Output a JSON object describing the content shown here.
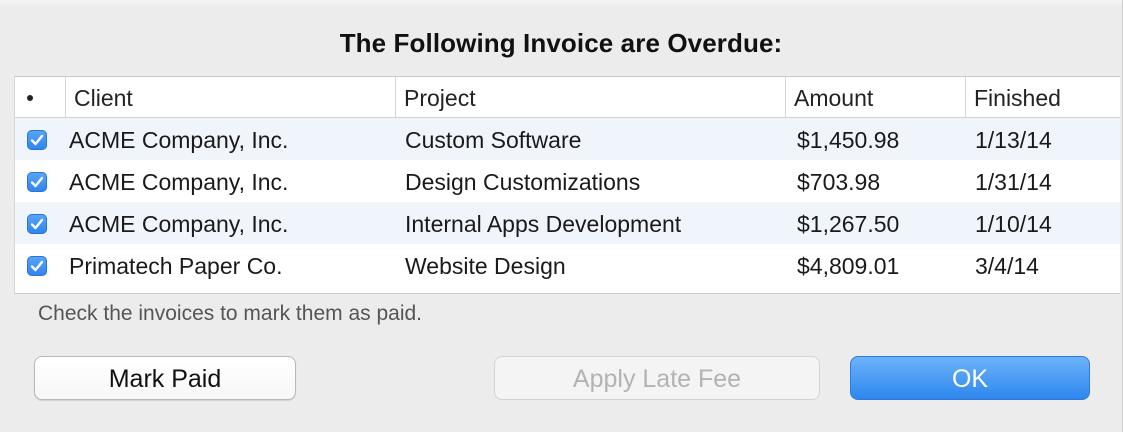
{
  "dialog": {
    "title": "The Following Invoice are Overdue:",
    "hint": "Check the invoices to mark them as paid.",
    "buttons": {
      "mark_paid": "Mark Paid",
      "apply_late_fee": "Apply Late Fee",
      "ok": "OK"
    },
    "accent_color": "#3b8df2"
  },
  "table": {
    "columns": {
      "select": "•",
      "client": "Client",
      "project": "Project",
      "amount": "Amount",
      "finished": "Finished"
    },
    "rows": [
      {
        "checked": true,
        "client": "ACME Company, Inc.",
        "project": "Custom Software",
        "amount": "$1,450.98",
        "finished": "1/13/14"
      },
      {
        "checked": true,
        "client": "ACME Company, Inc.",
        "project": "Design Customizations",
        "amount": "$703.98",
        "finished": "1/31/14"
      },
      {
        "checked": true,
        "client": "ACME Company, Inc.",
        "project": "Internal Apps Development",
        "amount": "$1,267.50",
        "finished": "1/10/14"
      },
      {
        "checked": true,
        "client": "Primatech Paper Co.",
        "project": "Website Design",
        "amount": "$4,809.01",
        "finished": "3/4/14"
      }
    ]
  }
}
